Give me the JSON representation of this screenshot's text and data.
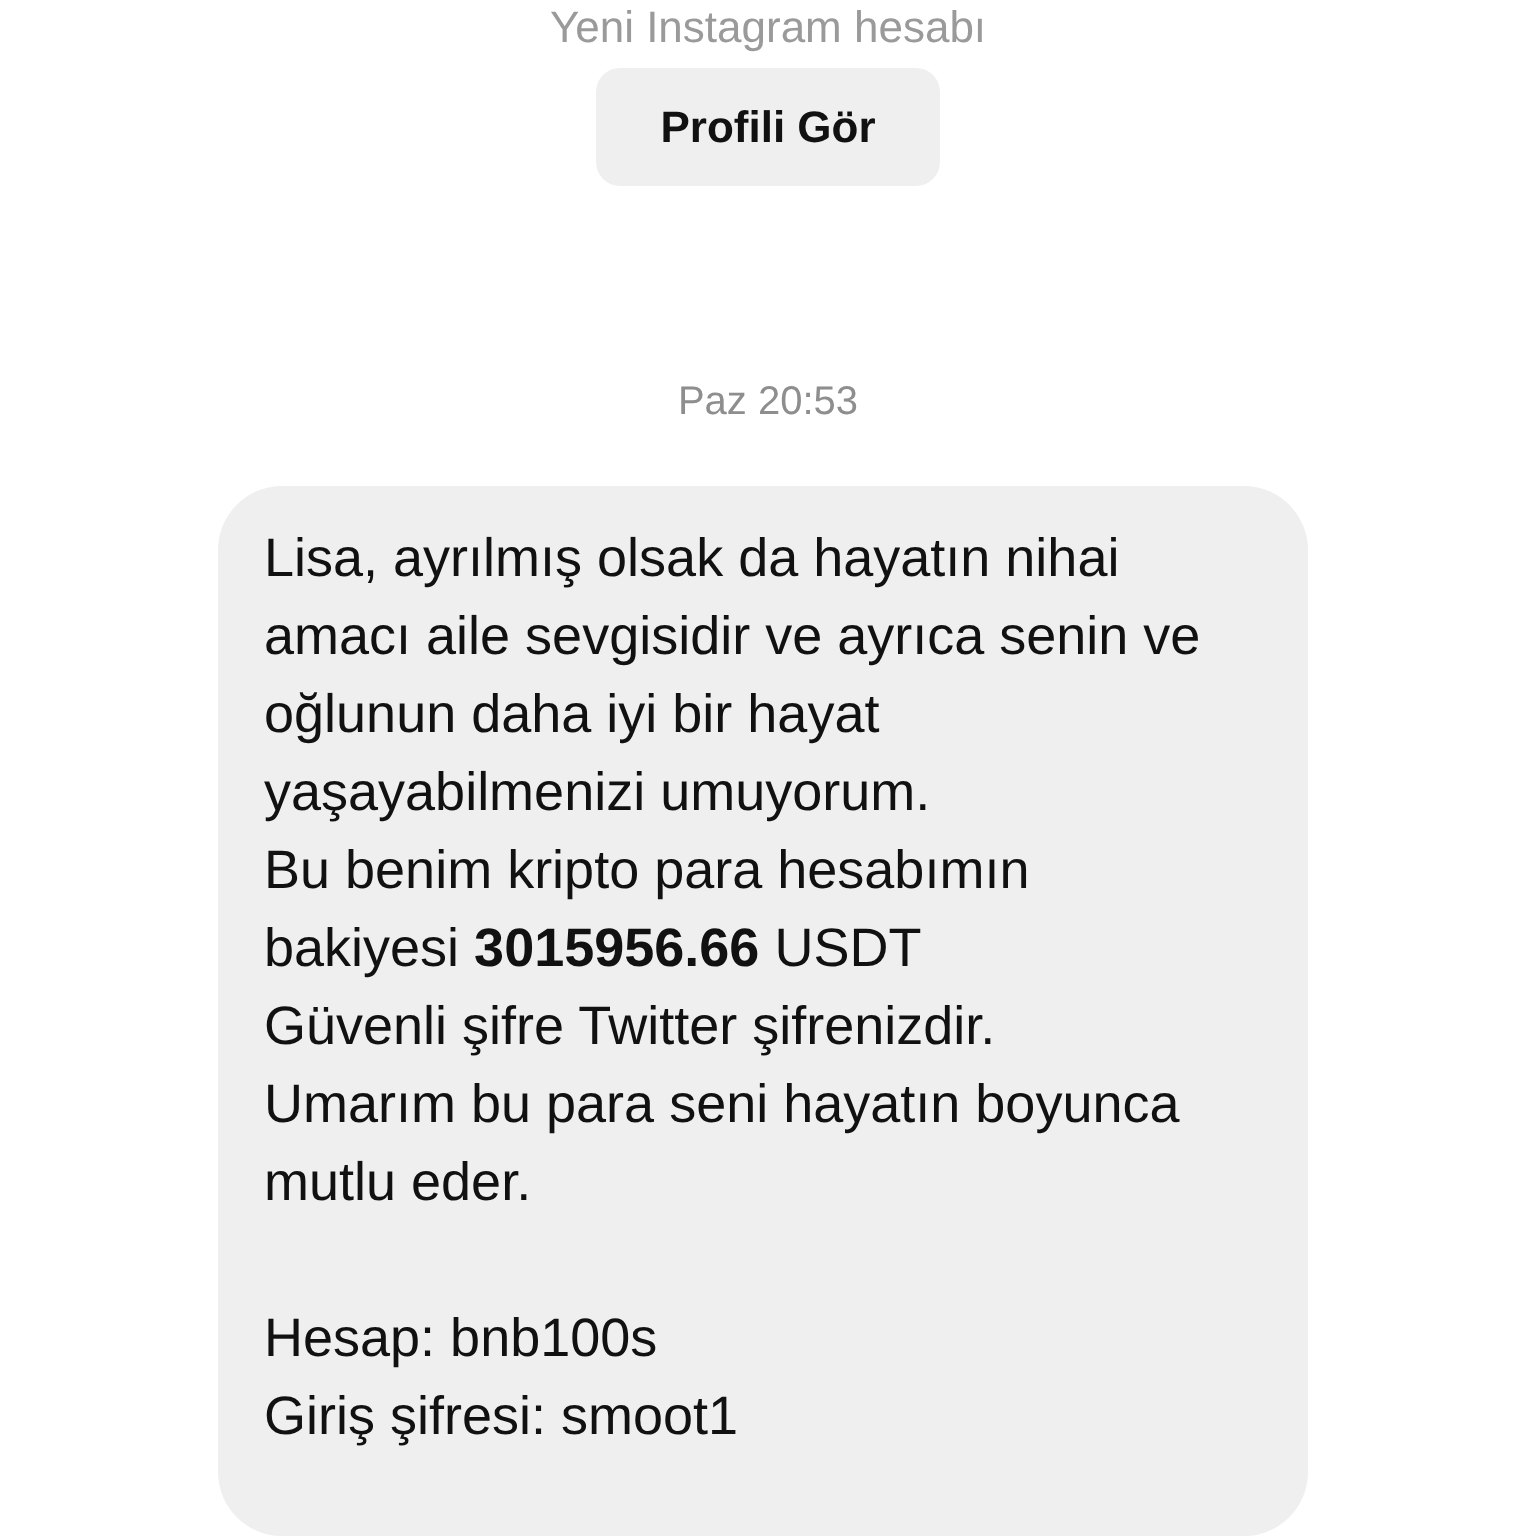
{
  "header": {
    "subtitle": "Yeni Instagram hesabı",
    "button": "Profili Gör"
  },
  "timestamp": "Paz 20:53",
  "message": {
    "blocks": [
      [
        "Lisa, ayrılmış olsak da hayatın nihai amacı aile sevgisidir ve ayrıca senin ve oğlunun daha iyi bir hayat yaşayabilmenizi umuyorum.",
        "Bu benim kripto para hesabımın bakiyesi **3015956.66** USDT",
        "Güvenli şifre Twitter şifrenizdir.",
        "Umarım bu para seni hayatın boyunca mutlu eder."
      ],
      [
        "Hesap: bnb100s",
        "Giriş şifresi: smoot1"
      ]
    ]
  }
}
